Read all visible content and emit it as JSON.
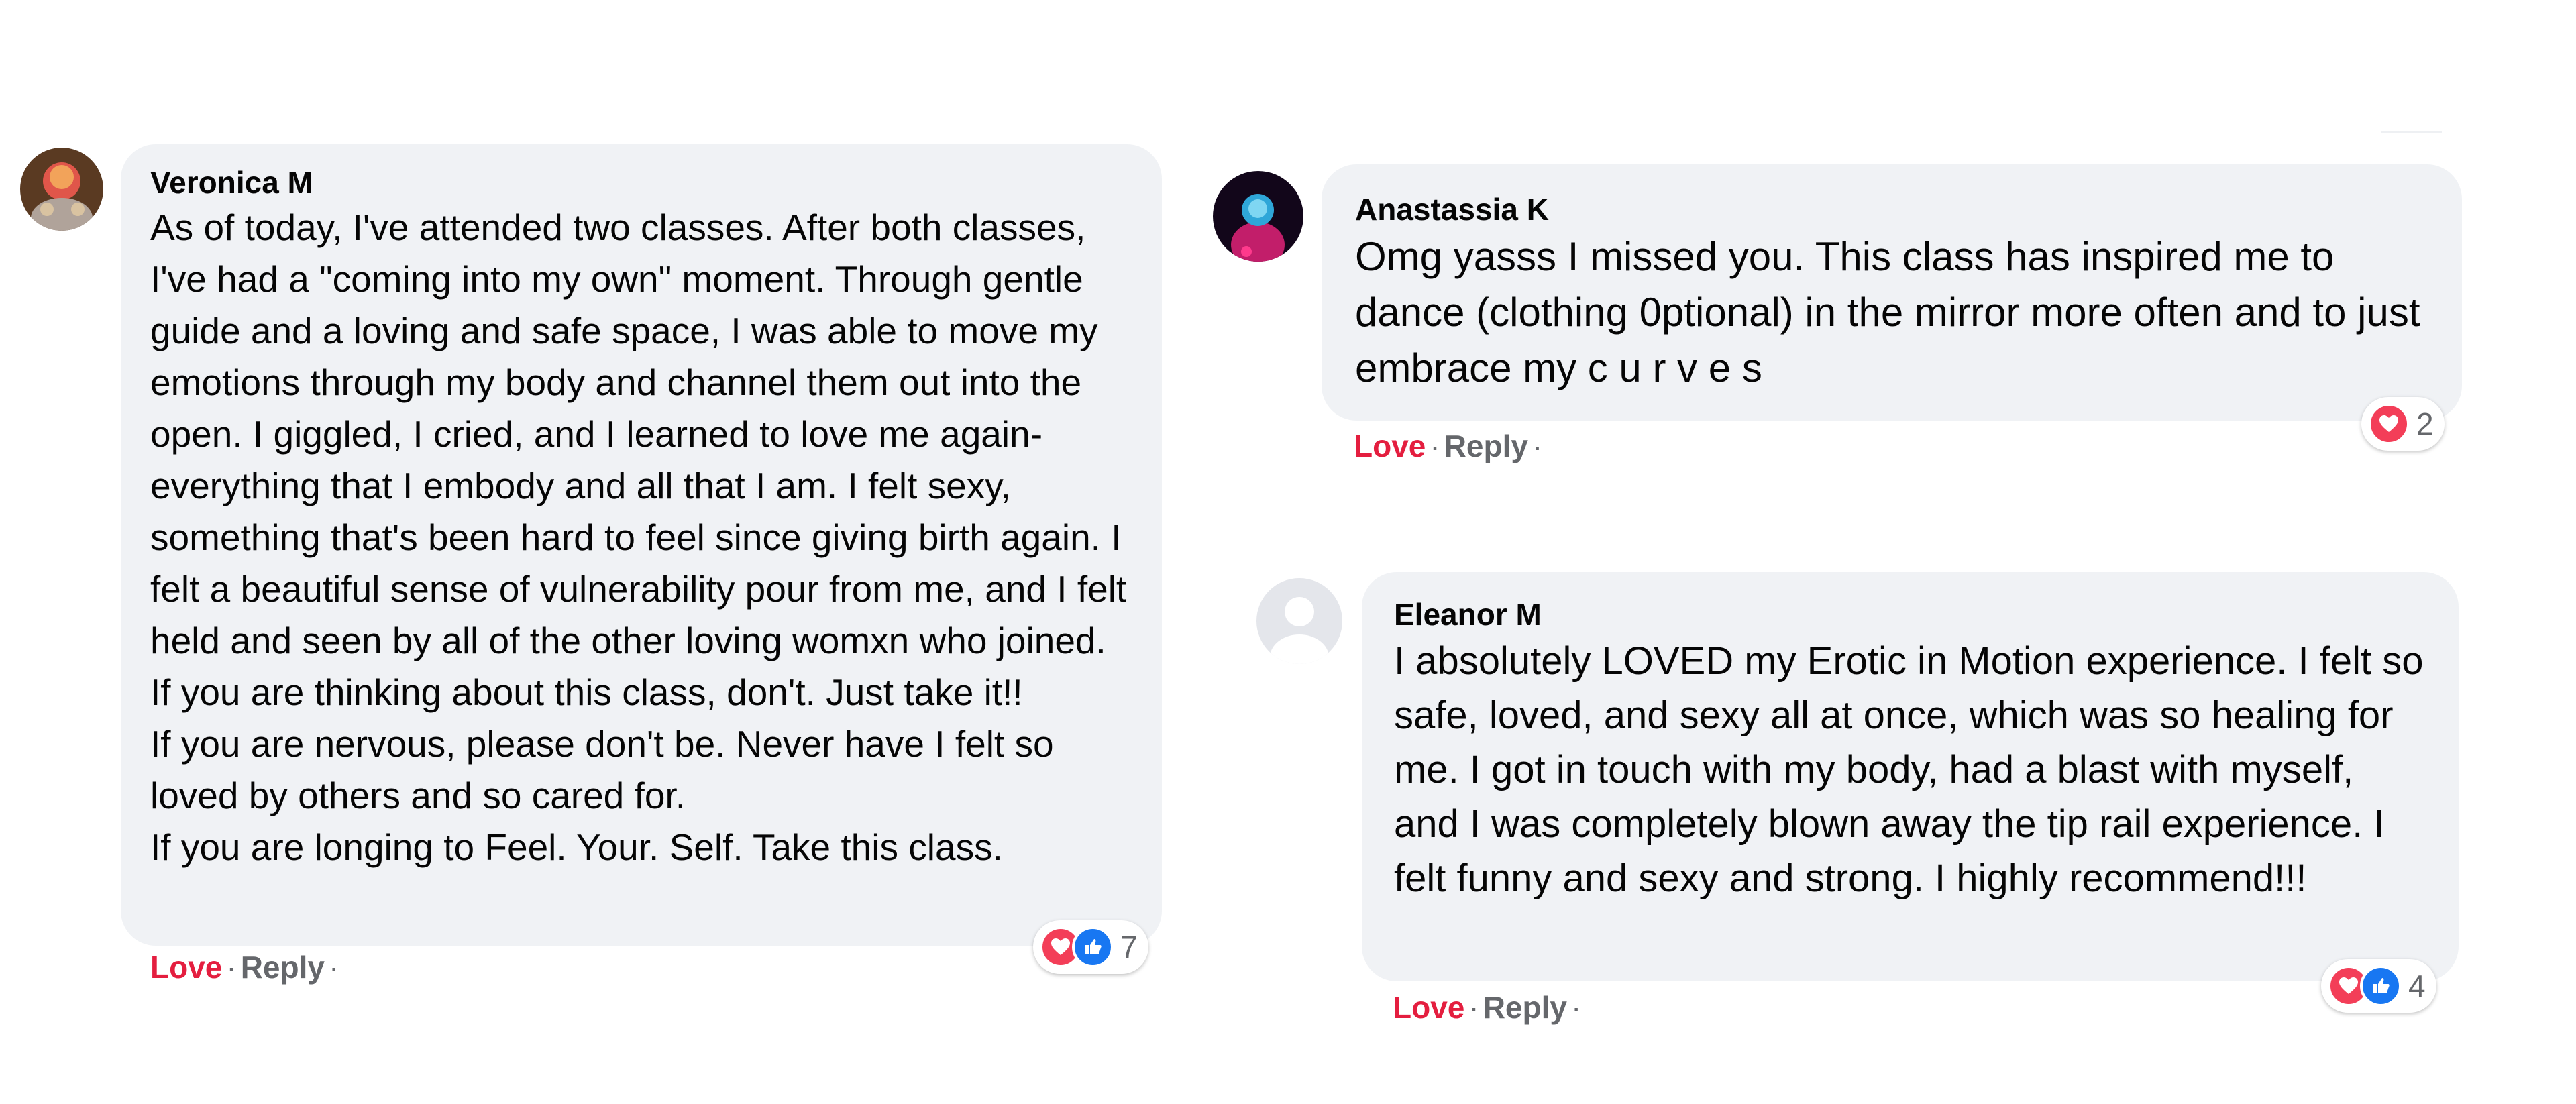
{
  "comments": [
    {
      "author": "Veronica M",
      "paragraphs": [
        "As of today, I've attended two classes. After both classes, I've had a \"coming into my own\" moment. Through gentle guide and a loving and safe space, I was able to move my emotions through my body and channel them out into the open. I giggled, I cried, and I learned to love me again- everything that I embody and all that I am. I felt sexy, something that's been hard to feel since giving birth again. I felt a beautiful sense of vulnerability pour from me, and I felt held and seen by all of the other loving womxn who joined.",
        "If you are thinking about this class, don't. Just take it!!",
        "If you are nervous, please don't be. Never have I felt so loved by others and so cared for.",
        "If you are longing to Feel. Your. Self. Take this class."
      ],
      "love_label": "Love",
      "reply_label": "Reply",
      "reaction_count": "7",
      "reactions": [
        "love-icon",
        "like-icon"
      ]
    },
    {
      "author": "Anastassia K",
      "paragraphs": [
        "Omg yasss I missed you. This class has inspired me to dance (clothing 0ptional) in the mirror more often and to just embrace my c u r v e s"
      ],
      "love_label": "Love",
      "reply_label": "Reply",
      "reaction_count": "2",
      "reactions": [
        "love-icon"
      ]
    },
    {
      "author": "Eleanor M",
      "paragraphs": [
        "I absolutely LOVED my Erotic in Motion experience. I felt so safe, loved, and sexy all at once, which was so healing for me. I got in touch with my body, had a blast with myself, and I was completely blown away the tip rail experience. I felt funny and sexy and strong. I highly recommend!!!"
      ],
      "love_label": "Love",
      "reply_label": "Reply",
      "reaction_count": "4",
      "reactions": [
        "love-icon",
        "like-icon"
      ]
    }
  ],
  "separator": "·",
  "colors": {
    "bubble": "#f0f2f5",
    "love": "#e41e3f",
    "muted": "#65676b",
    "love_reaction": "#f33e58",
    "like_reaction": "#1877f2"
  }
}
